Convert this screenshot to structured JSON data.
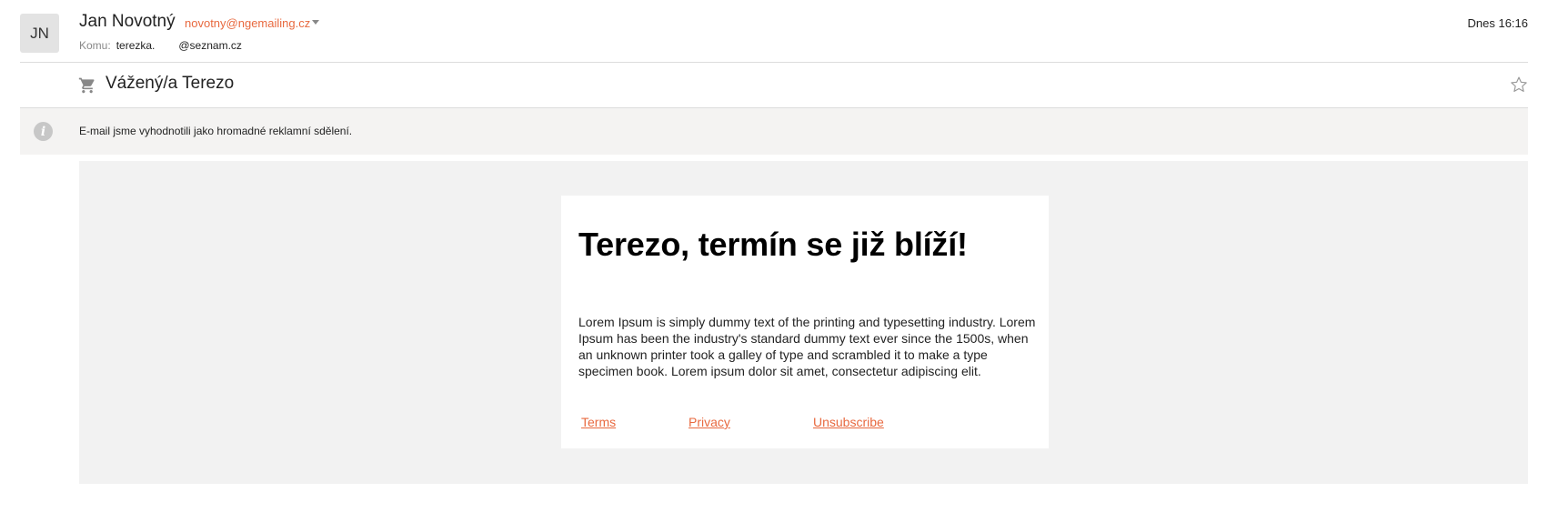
{
  "header": {
    "avatar_initials": "JN",
    "sender_name": "Jan Novotný",
    "sender_email": "novotny@ngemailing.cz",
    "to_label": "Komu:",
    "to_user": "terezka.",
    "to_domain": "@seznam.cz",
    "date": "Dnes 16:16"
  },
  "subject": {
    "icon": "cart-icon",
    "text": "Vážený/a Terezo",
    "star_icon": "star-icon"
  },
  "info_bar": {
    "icon": "info-icon",
    "text": "E-mail jsme vyhodnotili jako hromadné reklamní sdělení."
  },
  "email": {
    "heading": "Terezo, termín se již blíží!",
    "body": "Lorem Ipsum is simply dummy text of the printing and typesetting industry. Lorem Ipsum has been the industry's standard dummy text ever since the 1500s, when an unknown printer took a galley of type and scrambled it to make a type specimen book. Lorem ipsum dolor sit amet, consectetur adipiscing elit.",
    "links": {
      "terms": "Terms",
      "privacy": "Privacy",
      "unsubscribe": "Unsubscribe"
    }
  },
  "colors": {
    "accent": "#e8693f",
    "info_bar_bg": "#f4f3f2",
    "content_bg": "#f2f2f2"
  }
}
